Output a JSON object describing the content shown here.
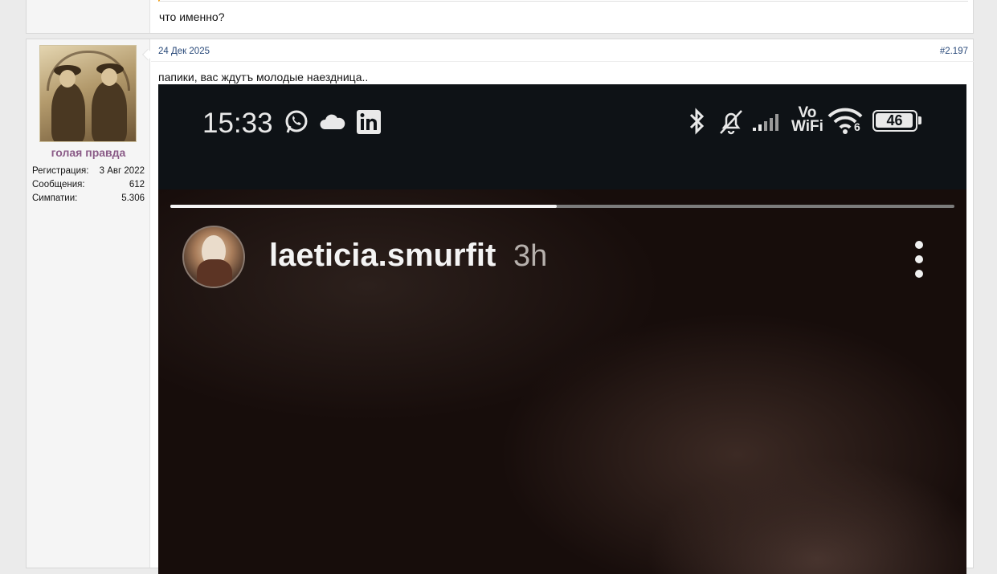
{
  "previous_post": {
    "text": "что именно?"
  },
  "post": {
    "user": {
      "name": "голая правда",
      "stats": [
        {
          "label": "Регистрация:",
          "value": "3 Авг 2022"
        },
        {
          "label": "Сообщения:",
          "value": "612"
        },
        {
          "label": "Симпатии:",
          "value": "5.306"
        }
      ]
    },
    "date": "24 Дек 2025",
    "number": "#2.197",
    "text": "папики, вас ждутъ молодые наездница.."
  },
  "story_image": {
    "clock": "15:33",
    "status_icons": [
      "whatsapp-icon",
      "cloud-icon",
      "linkedin-icon",
      "bluetooth-icon",
      "bell-muted-icon",
      "signal-icon",
      "vowifi-icon",
      "wifi-icon",
      "battery-icon"
    ],
    "vowifi_top": "Vo",
    "vowifi_bottom": "WiFi",
    "wifi_badge": "6",
    "battery_level": "46",
    "progress": 0.493,
    "username": "laeticia.smurfit",
    "time_ago": "3h"
  },
  "colors": {
    "username": "#8a5b87",
    "link": "#2a4a7a",
    "quote_accent": "#f5a623"
  }
}
